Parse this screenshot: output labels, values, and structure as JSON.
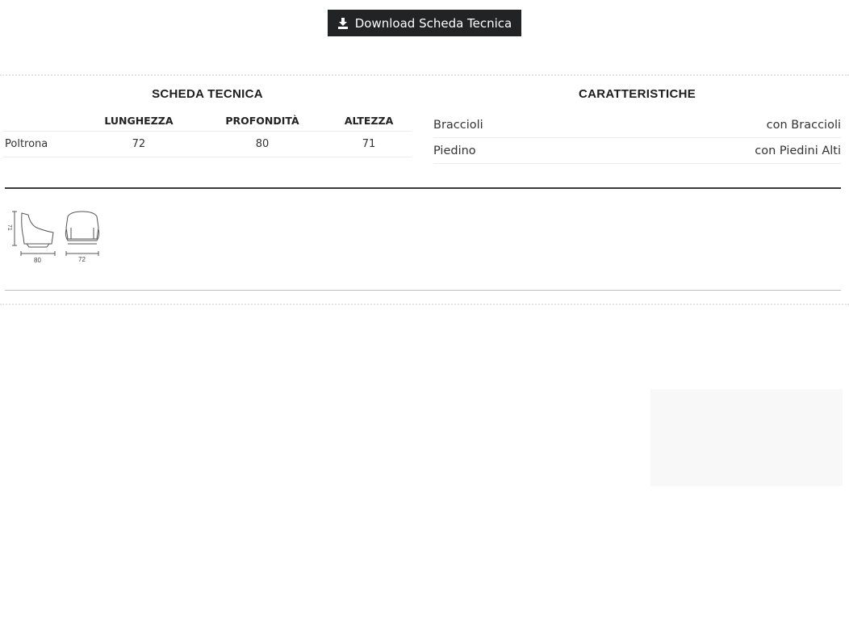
{
  "download": {
    "label": "Download Scheda Tecnica",
    "icon": "download-icon"
  },
  "scheda_tecnica": {
    "title": "SCHEDA TECNICA",
    "headers": [
      "LUNGHEZZA",
      "PROFONDITÀ",
      "ALTEZZA"
    ],
    "rows": [
      {
        "label": "Poltrona",
        "values": [
          "72",
          "80",
          "71"
        ]
      }
    ]
  },
  "caratteristiche": {
    "title": "CARATTERISTICHE",
    "rows": [
      {
        "label": "Braccioli",
        "value": "con Braccioli"
      },
      {
        "label": "Piedino",
        "value": "con Piedini Alti"
      }
    ]
  },
  "drawings": {
    "side": {
      "height_label": "71",
      "depth_label": "80"
    },
    "front": {
      "width_label": "72"
    }
  }
}
